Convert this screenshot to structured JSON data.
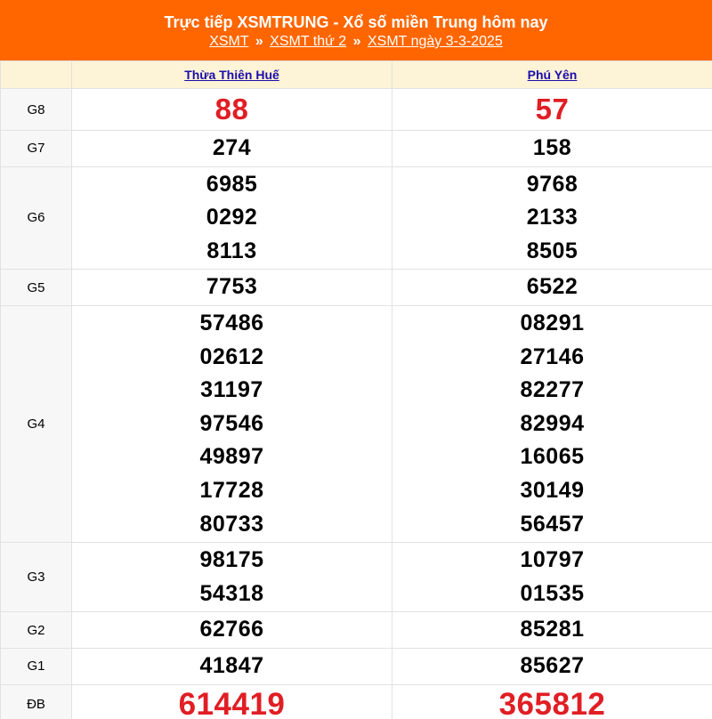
{
  "header": {
    "title": "Trực tiếp XSMTRUNG - Xổ số miền Trung hôm nay",
    "breadcrumbs": [
      "XSMT",
      "XSMT thứ 2",
      "XSMT ngày 3-3-2025"
    ],
    "separator": "»",
    "background_color": "#ff6600"
  },
  "columns": [
    "Thừa Thiên Huế",
    "Phú Yên"
  ],
  "rows": [
    {
      "prize": "G8",
      "values": [
        [
          "88"
        ],
        [
          "57"
        ]
      ]
    },
    {
      "prize": "G7",
      "values": [
        [
          "274"
        ],
        [
          "158"
        ]
      ]
    },
    {
      "prize": "G6",
      "values": [
        [
          "6985",
          "0292",
          "8113"
        ],
        [
          "9768",
          "2133",
          "8505"
        ]
      ]
    },
    {
      "prize": "G5",
      "values": [
        [
          "7753"
        ],
        [
          "6522"
        ]
      ]
    },
    {
      "prize": "G4",
      "values": [
        [
          "57486",
          "02612",
          "31197",
          "97546",
          "49897",
          "17728",
          "80733"
        ],
        [
          "08291",
          "27146",
          "82277",
          "82994",
          "16065",
          "30149",
          "56457"
        ]
      ]
    },
    {
      "prize": "G3",
      "values": [
        [
          "98175",
          "54318"
        ],
        [
          "10797",
          "01535"
        ]
      ]
    },
    {
      "prize": "G2",
      "values": [
        [
          "62766"
        ],
        [
          "85281"
        ]
      ]
    },
    {
      "prize": "G1",
      "values": [
        [
          "41847"
        ],
        [
          "85627"
        ]
      ]
    },
    {
      "prize": "ĐB",
      "values": [
        [
          "614419"
        ],
        [
          "365812"
        ]
      ]
    }
  ],
  "colors": {
    "highlight_number": "#e01e24",
    "link": "#1a0dab",
    "column_header_bg": "#fdf3d6"
  }
}
